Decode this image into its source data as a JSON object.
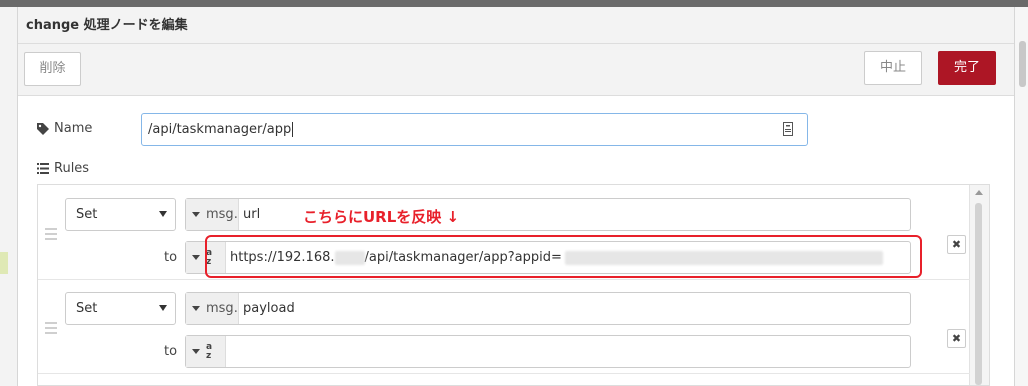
{
  "dialog": {
    "title": "change 処理ノードを編集",
    "buttons": {
      "delete": "削除",
      "cancel": "中止",
      "done": "完了"
    }
  },
  "form": {
    "name_label": "Name",
    "name_value": "/api/taskmanager/app",
    "rules_label": "Rules"
  },
  "rules": [
    {
      "action": "Set",
      "property_prefix": "msg.",
      "property": "url",
      "to_label": "to",
      "value_type_icon": "az-string-icon",
      "value_prefix": "https://192.168.",
      "value_middle": "/api/taskmanager/app?appid="
    },
    {
      "action": "Set",
      "property_prefix": "msg.",
      "property": "payload",
      "to_label": "to",
      "value_type_icon": "az-string-icon",
      "value_prefix": "",
      "value_middle": ""
    }
  ],
  "annotation": {
    "text": "こちらにURLを反映 ↓",
    "color": "#e8202a"
  },
  "colors": {
    "primary": "#ad1625",
    "focus_border": "#85b7e8"
  },
  "icons": [
    "tag-icon",
    "list-icon",
    "document-icon",
    "close-icon",
    "drag-handle-icon",
    "chevron-down-icon"
  ]
}
